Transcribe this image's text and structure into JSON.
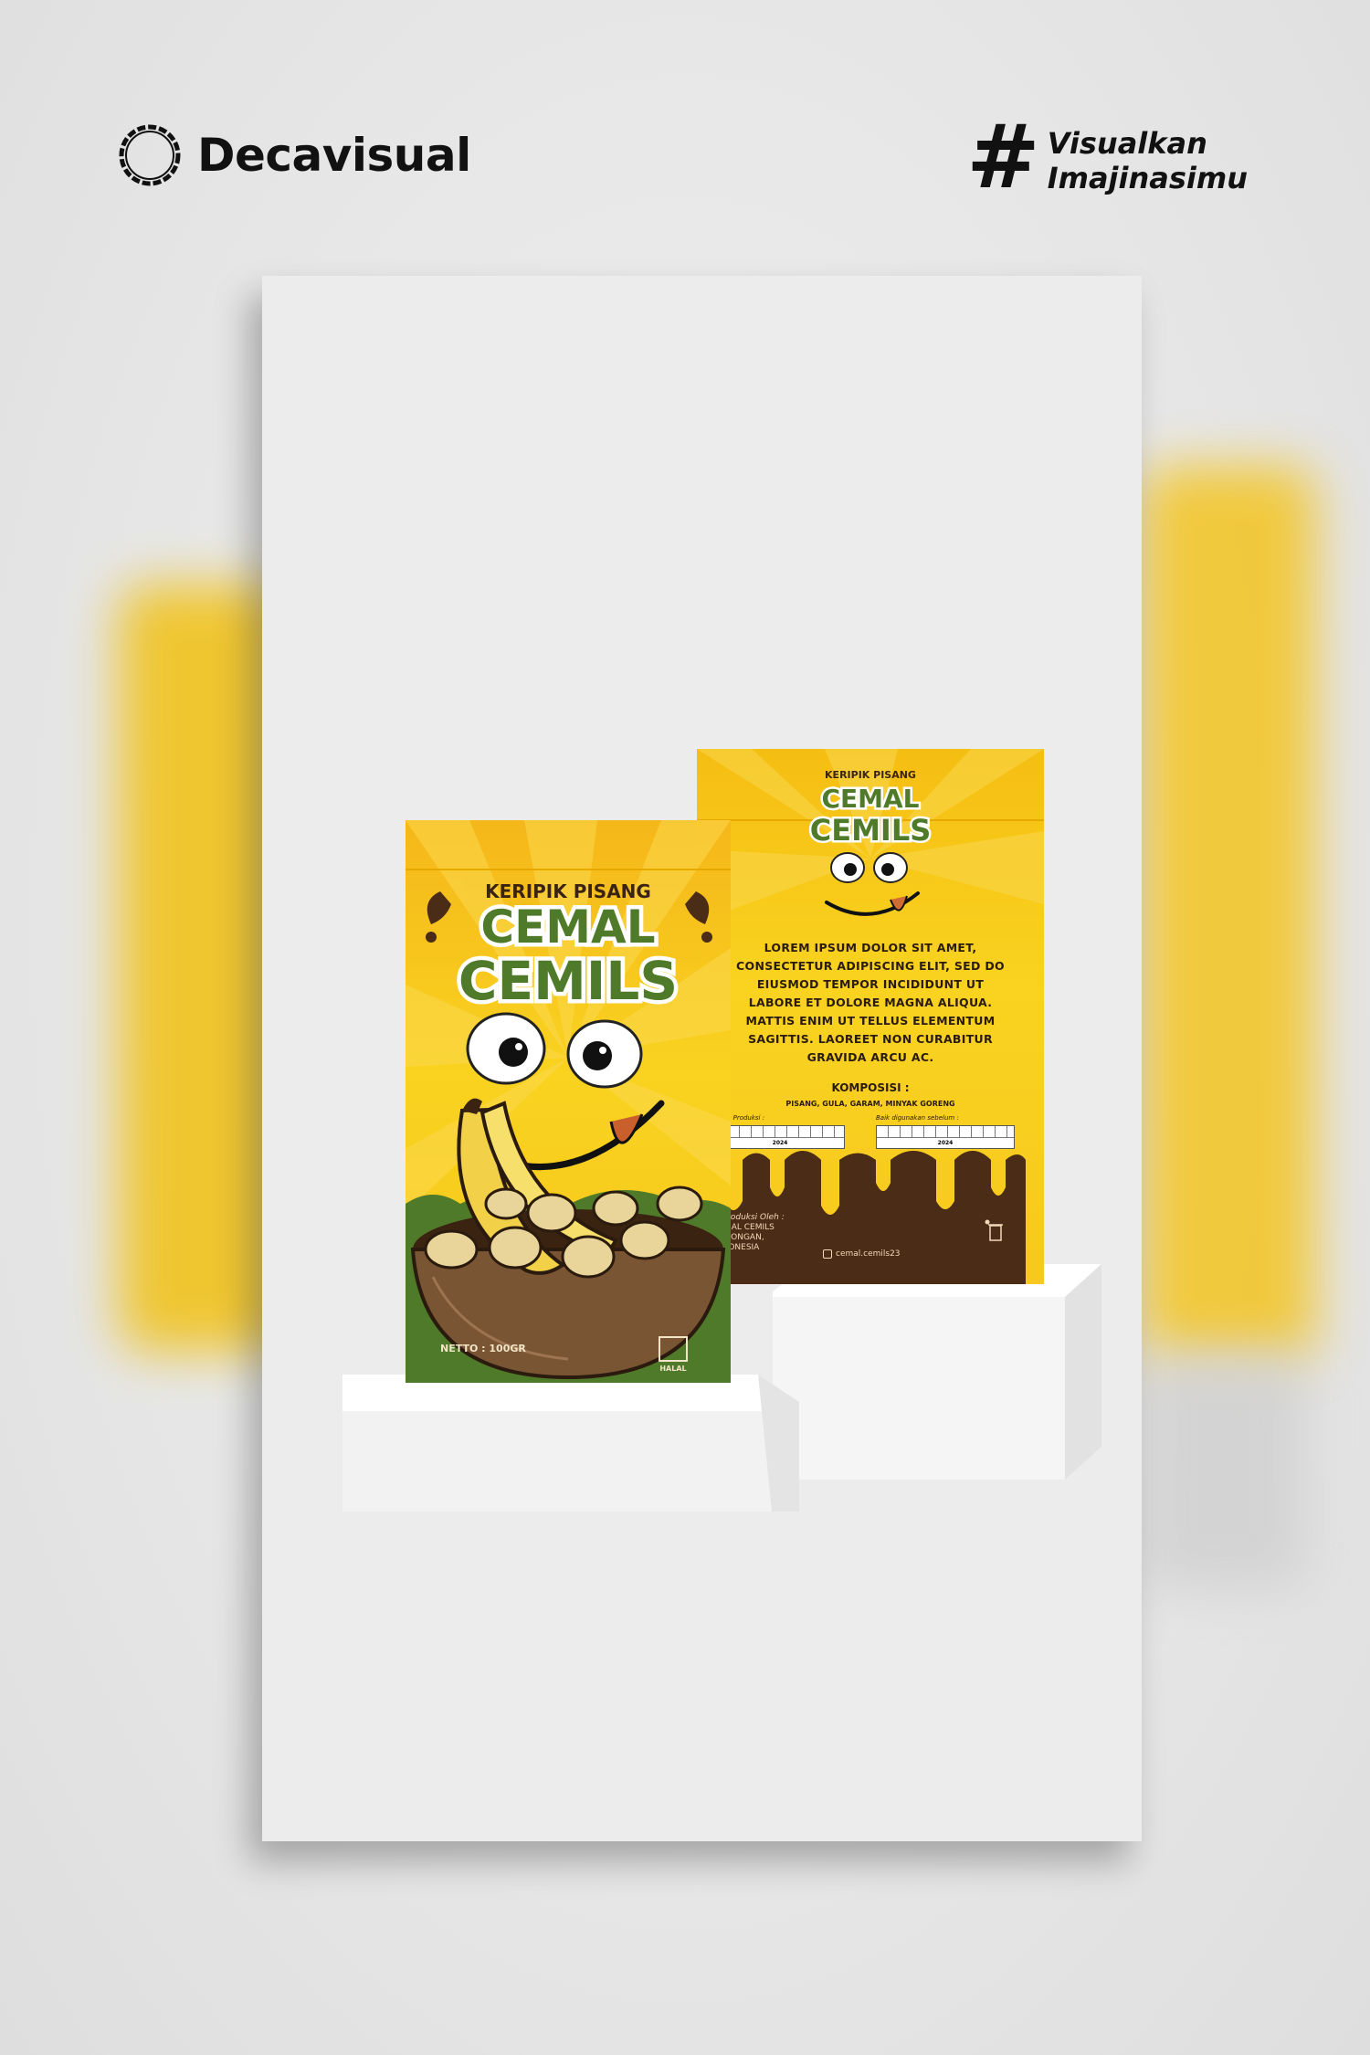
{
  "header": {
    "logo_name": "Decavisual",
    "tag_symbol": "#",
    "tag_line_1": "Visualkan",
    "tag_line_2": "Imajinasimu"
  },
  "front_pouch": {
    "subtitle": "KERIPIK PISANG",
    "brand_line_1": "CEMAL",
    "brand_line_2": "CEMILS",
    "netto": "NETTO : 100GR",
    "halal": "HALAL"
  },
  "back_pouch": {
    "subtitle": "KERIPIK PISANG",
    "brand_line_1": "CEMAL",
    "brand_line_2": "CEMILS",
    "description": "LOREM IPSUM DOLOR SIT AMET, CONSECTETUR ADIPISCING ELIT, SED DO EIUSMOD TEMPOR INCIDIDUNT UT LABORE ET DOLORE MAGNA ALIQUA. MATTIS ENIM UT TELLUS ELEMENTUM SAGITTIS. LAOREET NON CURABITUR GRAVIDA ARCU AC.",
    "komposisi_title": "KOMPOSISI :",
    "komposisi_items": "PISANG, GULA, GARAM, MINYAK GORENG",
    "kode_produksi_label": "Kode Produksi :",
    "baik_digunakan_label": "Baik digunakan sebelum :",
    "year_1": "2024",
    "year_2": "2024",
    "produced_by_label": "Diproduksi Oleh :",
    "producer_name": "CEMAL CEMILS",
    "producer_city": "LAMONGAN,",
    "producer_country": "INDONESIA",
    "instagram": "cemal.cemils23"
  },
  "colors": {
    "pouch_yellow": "#f7c81e",
    "pouch_yellow_dark": "#f2a900",
    "chocolate": "#4a2c17",
    "brand_green": "#4f7a2a",
    "podium": "#fafafa"
  }
}
